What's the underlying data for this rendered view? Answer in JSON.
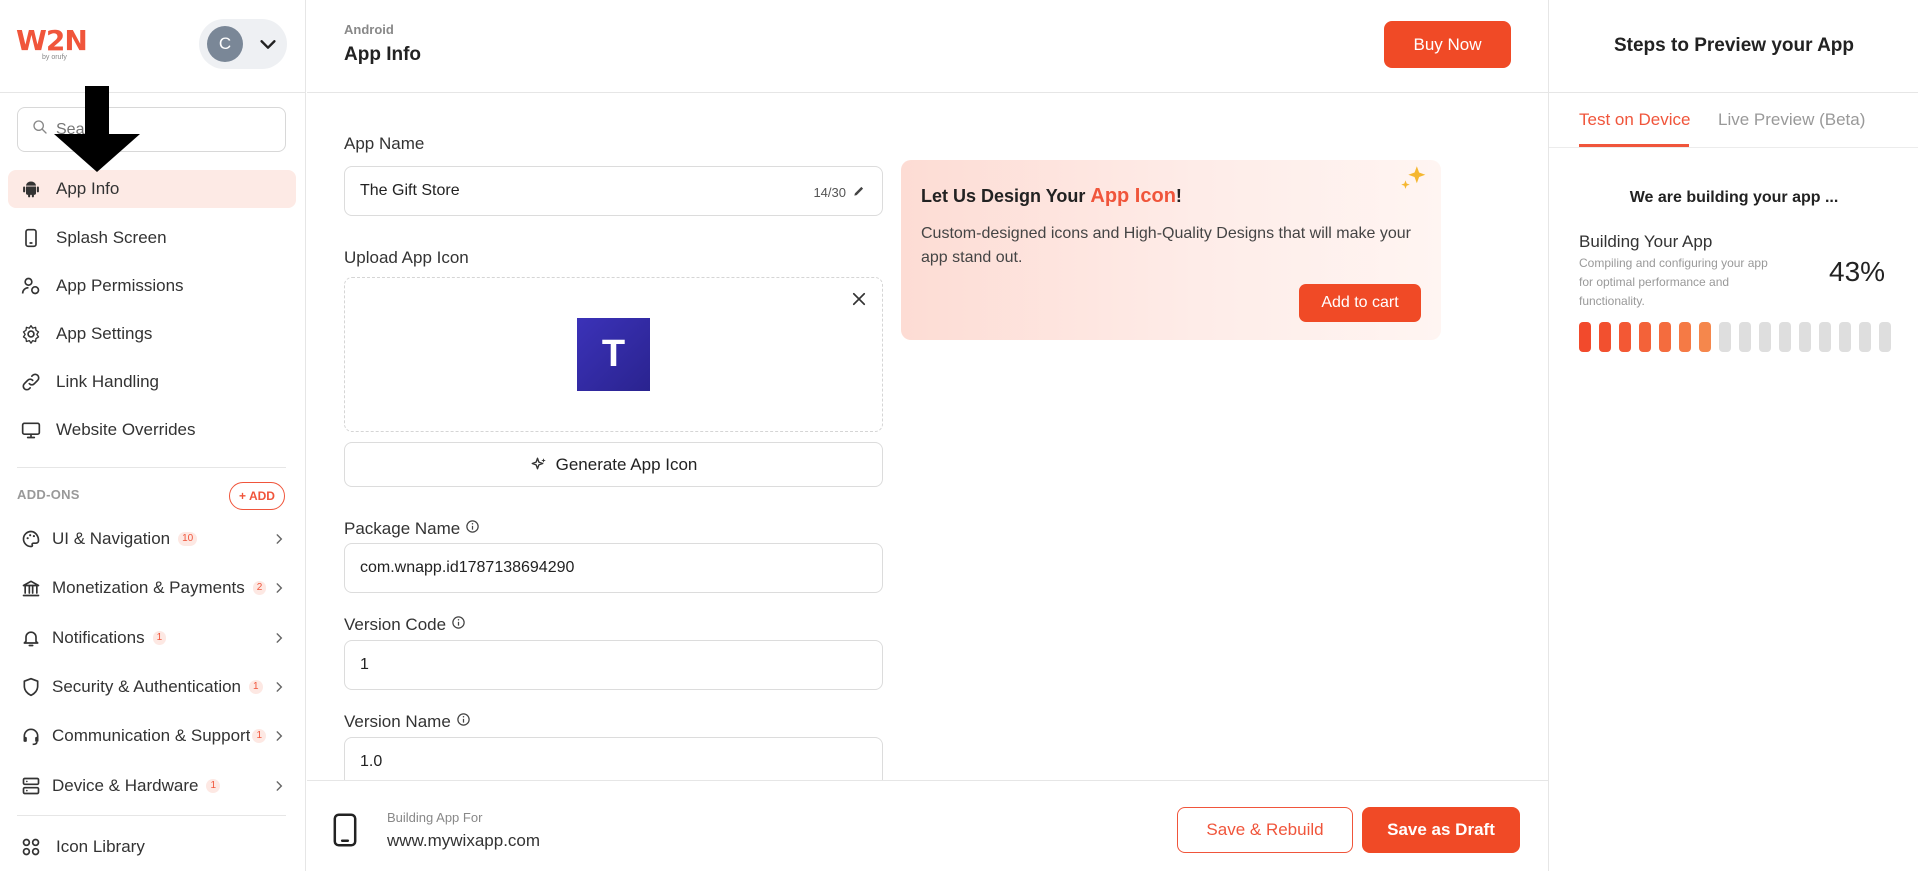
{
  "brand": {
    "logo": "W2N",
    "tagline": "by orufy"
  },
  "account": {
    "initial": "C"
  },
  "search": {
    "placeholder": "Search"
  },
  "sidebar": {
    "items": [
      {
        "label": "App Info",
        "icon": "android-icon",
        "active": true
      },
      {
        "label": "Splash Screen",
        "icon": "phone-icon"
      },
      {
        "label": "App Permissions",
        "icon": "user-lock-icon"
      },
      {
        "label": "App Settings",
        "icon": "gear-icon"
      },
      {
        "label": "Link Handling",
        "icon": "link-icon"
      },
      {
        "label": "Website Overrides",
        "icon": "monitor-icon"
      }
    ],
    "addons_label": "ADD-ONS",
    "add_label": "+ ADD",
    "addons": [
      {
        "label": "UI & Navigation",
        "badge": "10",
        "icon": "palette-icon"
      },
      {
        "label": "Monetization & Payments",
        "badge": "2",
        "icon": "bank-icon"
      },
      {
        "label": "Notifications",
        "badge": "1",
        "icon": "bell-icon"
      },
      {
        "label": "Security & Authentication",
        "badge": "1",
        "icon": "shield-icon"
      },
      {
        "label": "Communication & Support",
        "badge": "1",
        "icon": "headset-icon"
      },
      {
        "label": "Device & Hardware",
        "badge": "1",
        "icon": "server-icon"
      }
    ],
    "icon_library": "Icon Library"
  },
  "header": {
    "platform": "Android",
    "title": "App Info",
    "buy_label": "Buy Now"
  },
  "form": {
    "app_name_label": "App Name",
    "app_name_value": "The Gift Store",
    "app_name_counter": "14/30",
    "upload_label": "Upload App Icon",
    "icon_letter": "T",
    "generate_label": "Generate App Icon",
    "package_label": "Package Name",
    "package_value": "com.wnapp.id1787138694290",
    "version_code_label": "Version Code",
    "version_code_value": "1",
    "version_name_label": "Version Name",
    "version_name_value": "1.0"
  },
  "promo": {
    "title_prefix": "Let Us Design Your ",
    "title_highlight": "App Icon",
    "title_suffix": "!",
    "description": "Custom-designed icons and High-Quality Designs that will make your app stand out.",
    "cart_label": "Add to cart"
  },
  "footer": {
    "building_label": "Building App For",
    "url": "www.mywixapp.com",
    "rebuild_label": "Save & Rebuild",
    "draft_label": "Save as Draft"
  },
  "right_panel": {
    "title": "Steps to Preview your App",
    "tabs": [
      "Test on Device",
      "Live Preview (Beta)"
    ],
    "status": "We are building your app ...",
    "build_title": "Building Your App",
    "build_desc": "Compiling and configuring your app for optimal performance and functionality.",
    "progress_text": "43%",
    "progress": 0.43
  },
  "colors": {
    "accent": "#f04a26",
    "accent_light": "#fdeae5"
  }
}
